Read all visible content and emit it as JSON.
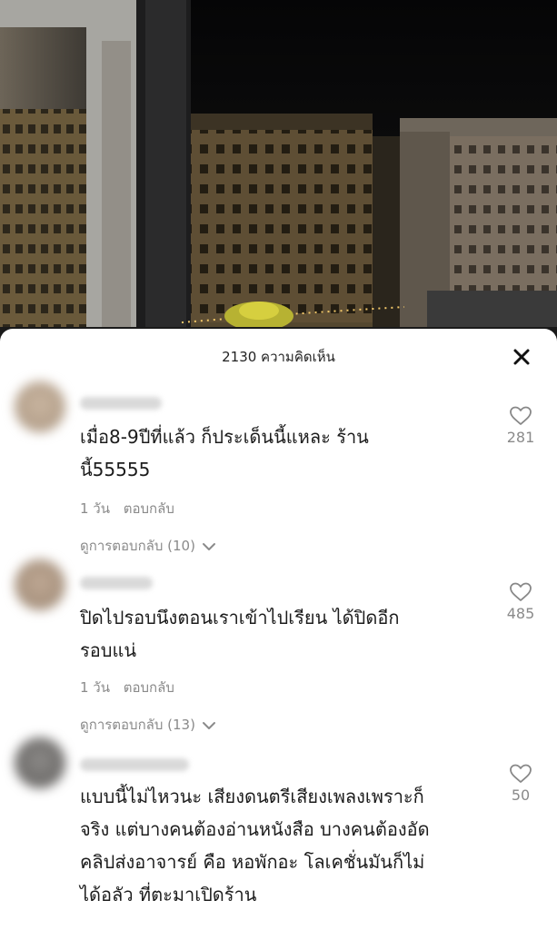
{
  "header": {
    "comment_count_label": "2130 ความคิดเห็น"
  },
  "comments": [
    {
      "text_line1": "เมื่อ8-9ปีที่แล้ว ก็ประเด็นนี้แหละ ร้าน",
      "text_line2": "นี้55555",
      "time": "1 วัน",
      "reply_label": "ตอบกลับ",
      "view_replies": "ดูการตอบกลับ (10)",
      "likes": "281"
    },
    {
      "text_line1": "ปิดไปรอบนึงตอนเราเข้าไปเรียน ได้ปิดอีก",
      "text_line2": "รอบแน่",
      "time": "1 วัน",
      "reply_label": "ตอบกลับ",
      "view_replies": "ดูการตอบกลับ (13)",
      "likes": "485"
    },
    {
      "text_line1": "แบบนี้ไม่ไหวนะ เสียงดนตรีเสียงเพลงเพราะก็",
      "text_line2": "จริง แต่บางคนต้องอ่านหนังสือ บางคนต้องอัด",
      "text_line3": "คลิปส่งอาจารย์ คือ หอพักอะ โลเคชั่นมันก็ไม่",
      "text_line4": "ได้อลัว ที่ตะมาเปิดร้าน",
      "likes": "50"
    }
  ],
  "icons": {
    "close": "close-icon",
    "like": "heart-outline-icon",
    "expand": "chevron-down-icon"
  },
  "colors": {
    "text_primary": "#1c1c1c",
    "text_secondary": "#8a8a8a",
    "sheet_bg": "#ffffff"
  }
}
